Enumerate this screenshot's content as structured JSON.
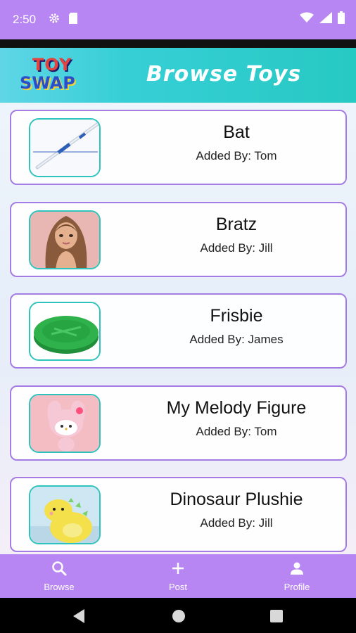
{
  "status_bar": {
    "time": "2:50",
    "icons_left": [
      "gear-icon",
      "sd-card-icon"
    ],
    "icons_right": [
      "wifi-icon",
      "signal-icon",
      "battery-icon"
    ]
  },
  "header": {
    "logo_top": "TOY",
    "logo_bottom": "SWAP",
    "title": "Browse Toys"
  },
  "toys": [
    {
      "name": "Bat",
      "added_by": "Added By: Tom",
      "thumb": "baseball-bat"
    },
    {
      "name": "Bratz",
      "added_by": "Added By: Jill",
      "thumb": "doll"
    },
    {
      "name": "Frisbie",
      "added_by": "Added By: James",
      "thumb": "frisbee"
    },
    {
      "name": "My Melody Figure",
      "added_by": "Added By: Tom",
      "thumb": "melody-figure"
    },
    {
      "name": "Dinosaur Plushie",
      "added_by": "Added By: Jill",
      "thumb": "dinosaur-plush"
    }
  ],
  "bottom_nav": {
    "items": [
      {
        "label": "Browse",
        "icon": "search-icon"
      },
      {
        "label": "Post",
        "icon": "plus-icon"
      },
      {
        "label": "Profile",
        "icon": "person-icon"
      }
    ]
  },
  "colors": {
    "primary": "#b886f2",
    "header_teal": "#2cc9c6",
    "card_border": "#a57ce3",
    "thumb_border": "#2fc3bd"
  }
}
